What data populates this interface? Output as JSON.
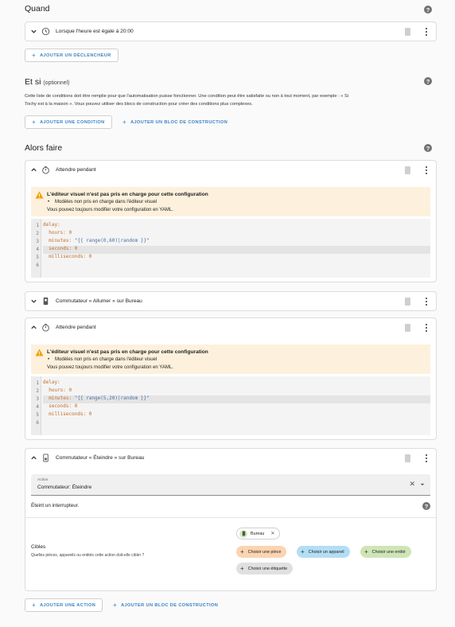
{
  "triggers": {
    "title": "Quand",
    "items": [
      {
        "label": "Lorsque l'heure est égale à 20:00"
      }
    ],
    "add_label": "AJOUTER UN DÉCLENCHEUR"
  },
  "conditions": {
    "title": "Et si",
    "optional": "(optionnel)",
    "description_line1": "Cette liste de conditions doit être remplie pour que l'automatisation puisse fonctionner. Une condition peut être satisfaite ou non à tout moment, par exemple : « Si",
    "description_line2": "Tochy est à la maison ». Vous pouvez utiliser des blocs de construction pour créer des conditions plus complexes.",
    "add_label": "AJOUTER UNE CONDITION",
    "add_block_label": "AJOUTER UN BLOC DE CONSTRUCTION"
  },
  "actions": {
    "title": "Alors faire",
    "items": [
      {
        "label": "Attendre pendant",
        "warning": {
          "title": "L'éditeur visuel n'est pas pris en charge pour cette configuration",
          "bullet": "Modèles non pris en charge dans l'éditeur visuel",
          "line": "Vous pouvez toujours modifier votre configuration en YAML."
        },
        "code": {
          "line_numbers": [
            "1",
            "2",
            "3",
            "4",
            "5",
            "6"
          ],
          "l1": "delay:",
          "l2": "  hours: 0",
          "l3_key": "  minutes: ",
          "l3_val": "\"{{ range(0,60)|random }}\"",
          "l4": "  seconds: 0",
          "l5": "  milliseconds: 0"
        }
      },
      {
        "label": "Commutateur « Allumer » sur Bureau"
      },
      {
        "label": "Attendre pendant",
        "warning": {
          "title": "L'éditeur visuel n'est pas pris en charge pour cette configuration",
          "bullet": "Modèles non pris en charge dans l'éditeur visuel",
          "line": "Vous pouvez toujours modifier votre configuration en YAML."
        },
        "code": {
          "line_numbers": [
            "1",
            "2",
            "3",
            "4",
            "5",
            "6"
          ],
          "l1": "delay:",
          "l2": "  hours: 0",
          "l3_key": "  minutes: ",
          "l3_val": "\"{{ range(5,20)|random }}\"",
          "l4": "  seconds: 0",
          "l5": "  milliseconds: 0"
        }
      },
      {
        "label": "Commutateur « Éteindre » sur Bureau",
        "action_field_label": "Action",
        "action_field_value": "Commutateur: Éteindre",
        "action_description": "Éteint un interrupteur.",
        "targets_title": "Cibles",
        "targets_description": "Quelles pièces, appareils ou entités cette action doit-elle cibler ?",
        "selected_target": "Bureau",
        "choose_area": "Choisir une pièce",
        "choose_device": "Choisir un appareil",
        "choose_entity": "Choisir une entité",
        "choose_label": "Choisir une étiquette"
      }
    ],
    "add_label": "AJOUTER UNE ACTION",
    "add_block_label": "AJOUTER UN BLOC DE CONSTRUCTION"
  },
  "colors": {
    "accent": "#3b82c4",
    "warning_bg": "#fdf1dd",
    "warning_icon": "#f2a007",
    "chip_area": "#fbd4b0",
    "chip_device": "#b3def3",
    "chip_entity": "#cfe5b5",
    "chip_label": "#e0e0e0"
  }
}
